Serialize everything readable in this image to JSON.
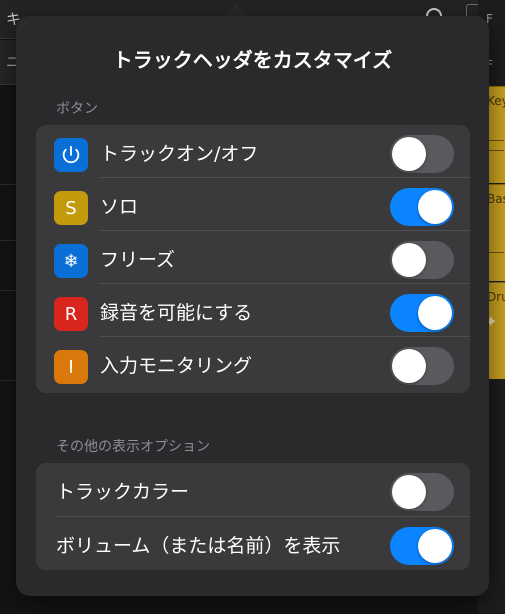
{
  "background": {
    "topbar_text": "キ",
    "row2_text": "ニ",
    "right_cap_top": "F",
    "right_cap_second": "F",
    "tracks": [
      {
        "label": "Key"
      },
      {
        "label": "Bas"
      },
      {
        "label": "Dru"
      }
    ]
  },
  "popover": {
    "title": "トラックヘッダをカスタマイズ",
    "sections": [
      {
        "header": "ボタン",
        "items": [
          {
            "icon": "power-icon",
            "glyph": "⏻",
            "color": "#0a6fd6",
            "label": "トラックオン/オフ",
            "on": false
          },
          {
            "icon": "solo-icon",
            "glyph": "S",
            "color": "#c29a0c",
            "label": "ソロ",
            "on": true
          },
          {
            "icon": "snowflake-icon",
            "glyph": "❄",
            "color": "#0a6fd6",
            "label": "フリーズ",
            "on": false
          },
          {
            "icon": "record-icon",
            "glyph": "R",
            "color": "#d8261e",
            "label": "録音を可能にする",
            "on": true
          },
          {
            "icon": "input-monitor-icon",
            "glyph": "I",
            "color": "#d9780b",
            "label": "入力モニタリング",
            "on": false
          }
        ]
      },
      {
        "header": "その他の表示オプション",
        "items": [
          {
            "label": "トラックカラー",
            "on": false
          },
          {
            "label": "ボリューム（または名前）を表示",
            "on": true
          }
        ]
      }
    ]
  }
}
